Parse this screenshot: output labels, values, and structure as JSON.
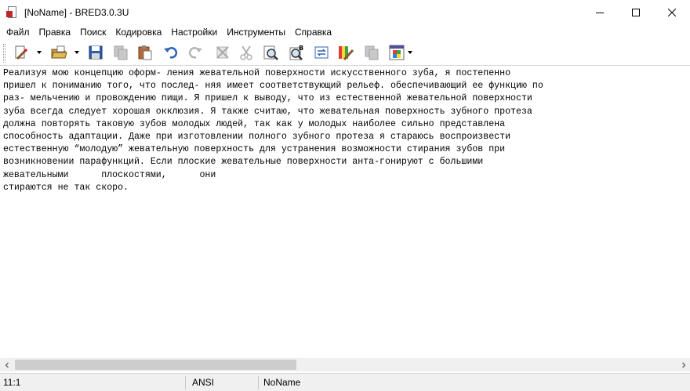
{
  "window": {
    "title": "[NoName] - BRED3.0.3U",
    "controls": [
      "minimize-icon",
      "maximize-icon",
      "close-icon"
    ]
  },
  "menu": {
    "items": [
      "Файл",
      "Правка",
      "Поиск",
      "Кодировка",
      "Настройки",
      "Инструменты",
      "Справка"
    ]
  },
  "toolbar": {
    "buttons": [
      "new-document-icon",
      "open-folder-icon",
      "save-icon",
      "copy-disabled-icon",
      "paste-icon",
      "undo-icon",
      "redo-icon",
      "clear-disabled-icon",
      "cut-disabled-icon",
      "find-icon",
      "find-next-icon",
      "replace-icon",
      "colors-icon",
      "settings-disabled-icon",
      "windows-icon"
    ]
  },
  "editor": {
    "lines": [
      "Реализуя мою концепцию оформ- ления жевательной поверхности искусственного зуба, я постепенно",
      "пришел к пониманию того, что послед- няя имеет соответствующий рельеф. обеспечивающий ее функцию по",
      "раз- мельчению и провождению пищи. Я пришел к выводу, что из естественной жевательной поверхности",
      "зуба всегда следует хорошая окклюзия. Я также считаю, что жевательная поверхность зубного протеза",
      "должна повторять таковую зубов молодых людей, так как у молодых наиболее сильно представлена",
      "способность адаптации. Даже при изготовлении полного зубного протеза я стараюсь воспроизвести",
      "естественную “молодую” жевательную поверхность для устранения возможности стирания зубов при",
      "возникновении парафункций. Если плоские жевательные поверхности анта-гонируют с большими",
      "жевательными      плоскостями,      они",
      "стираются не так скоро."
    ]
  },
  "statusbar": {
    "position": "11:1",
    "encoding": "ANSI",
    "filename": "NoName"
  }
}
